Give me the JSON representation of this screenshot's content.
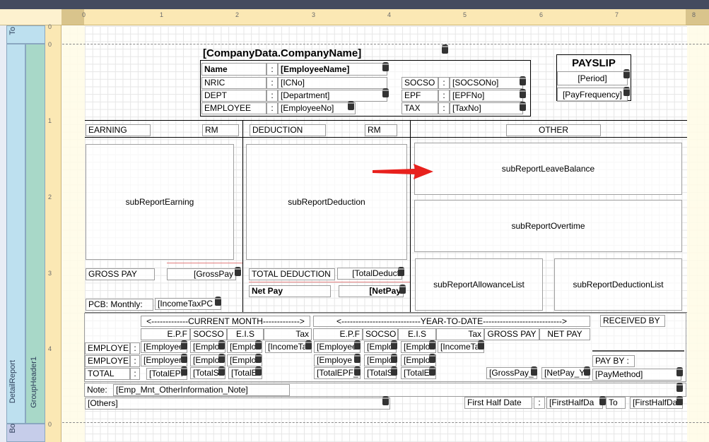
{
  "ruler": {
    "h_marks": [
      "0",
      "1",
      "2",
      "3",
      "4",
      "5",
      "6",
      "7",
      "8"
    ],
    "v_marks": [
      "0",
      "1",
      "2",
      "3",
      "4",
      "0"
    ],
    "v_top_mark": "0"
  },
  "sections": {
    "top": "To",
    "detail": "DetailReport",
    "group_header": "GroupHeader1",
    "bottom": "Bo"
  },
  "header": {
    "company": "[CompanyData.CompanyName]",
    "payslip_title": "PAYSLIP",
    "period": "[Period]",
    "pay_frequency": "[PayFrequency]",
    "colon": ":",
    "fields": [
      {
        "label": "Name",
        "value": "[EmployeeName]"
      },
      {
        "label": "NRIC",
        "value": "[ICNo]"
      },
      {
        "label": "DEPT",
        "value": "[Department]"
      },
      {
        "label": "EMPLOYEE",
        "value": "[EmployeeNo]"
      }
    ],
    "right_fields": [
      {
        "label": "SOCSO",
        "value": "[SOCSONo]"
      },
      {
        "label": "EPF",
        "value": "[EPFNo]"
      },
      {
        "label": "TAX",
        "value": "[TaxNo]"
      }
    ]
  },
  "columns": {
    "earning": "EARNING",
    "rm": "RM",
    "deduction": "DEDUCTION",
    "other": "OTHER"
  },
  "subreports": {
    "earning": "subReportEarning",
    "deduction": "subReportDeduction",
    "leave": "subReportLeaveBalance",
    "overtime": "subReportOvertime",
    "allowance": "subReportAllowanceList",
    "deduction_list": "subReportDeductionList"
  },
  "totals": {
    "gross_pay_label": "GROSS PAY",
    "gross_pay_value": "[GrossPay",
    "total_deduction_label": "TOTAL DEDUCTION",
    "total_deduction_value": "[TotalDeduct",
    "net_pay_label": "Net Pay",
    "net_pay_value": "[NetPay",
    "pcb_label": "PCB: Monthly:",
    "pcb_value": "[IncomeTaxPC"
  },
  "summary": {
    "current_month": "<-------------CURRENT MONTH------------->",
    "year_to_date": "<----------------------------YEAR-TO-DATE---------------------------->",
    "received_by": "RECEIVED BY",
    "cm_headers": [
      "E.P.F",
      "SOCSO",
      "E.I.S",
      "Tax"
    ],
    "ytd_headers": [
      "E.P.F",
      "SOCSO",
      "E.I.S",
      "Tax",
      "GROSS PAY",
      "NET PAY"
    ],
    "rows": [
      {
        "label": "EMPLOYEE",
        "cm": [
          "[Employee",
          "[Emplo",
          "[Emplo",
          "[IncomeTa"
        ],
        "ytd": [
          "[Employee",
          "[Emplo",
          "[Emplo",
          "[IncomeTa"
        ]
      },
      {
        "label": "EMPLOYER",
        "cm": [
          "[Employer",
          "[Emplo",
          "[Emplo"
        ],
        "ytd": [
          "[Employe",
          "[Emplo",
          "[Emplo"
        ]
      },
      {
        "label": "TOTAL",
        "cm": [
          "[TotalEPF",
          "[TotalS",
          "[TotalE"
        ],
        "ytd": [
          "[TotalEPF_",
          "[TotalS",
          "[TotalE",
          "[GrossPay_",
          "[NetPay_Y"
        ]
      }
    ],
    "pay_by_label": "PAY BY :",
    "pay_method": "[PayMethod]"
  },
  "footer": {
    "note_label": "Note:",
    "note_value": "[Emp_Mnt_OtherInformation_Note]",
    "others": "[Others]",
    "first_half_label": "First Half Date",
    "first_half_value": "[FirstHalfDa",
    "to_label": "To",
    "first_half_value2": "[FirstHalfDa"
  },
  "colors": {
    "arrow": "#e8211d",
    "ruler": "#fbe8b4",
    "section_band": "#bde0ef"
  }
}
